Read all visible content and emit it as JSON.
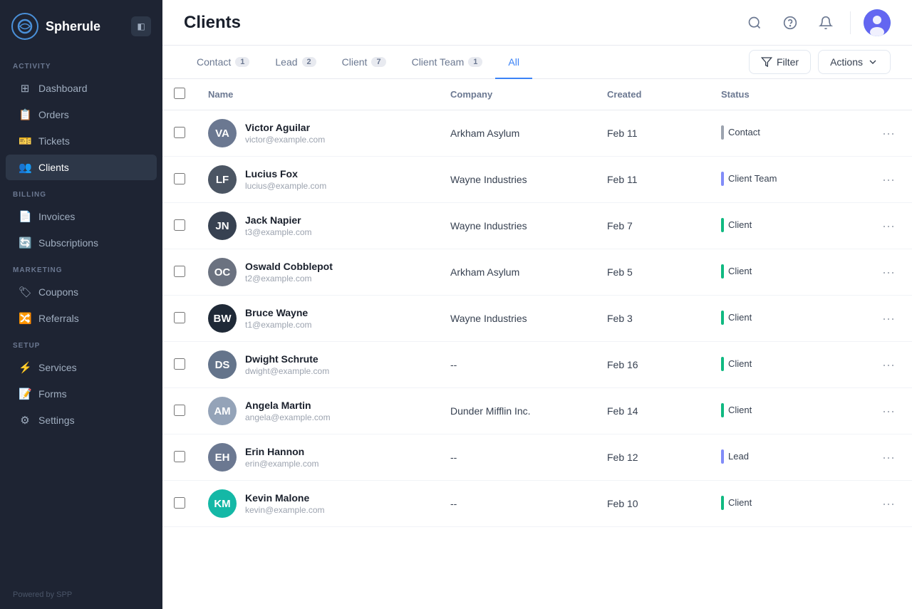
{
  "sidebar": {
    "logo": "Spherule",
    "sections": [
      {
        "label": "ACTIVITY",
        "items": [
          {
            "id": "dashboard",
            "label": "Dashboard",
            "icon": "⊞"
          },
          {
            "id": "orders",
            "label": "Orders",
            "icon": "📋"
          },
          {
            "id": "tickets",
            "label": "Tickets",
            "icon": "🎫"
          },
          {
            "id": "clients",
            "label": "Clients",
            "icon": "👥",
            "active": true
          }
        ]
      },
      {
        "label": "BILLING",
        "items": [
          {
            "id": "invoices",
            "label": "Invoices",
            "icon": "📄"
          },
          {
            "id": "subscriptions",
            "label": "Subscriptions",
            "icon": "🔄"
          }
        ]
      },
      {
        "label": "MARKETING",
        "items": [
          {
            "id": "coupons",
            "label": "Coupons",
            "icon": "🏷"
          },
          {
            "id": "referrals",
            "label": "Referrals",
            "icon": "🔀"
          }
        ]
      },
      {
        "label": "SETUP",
        "items": [
          {
            "id": "services",
            "label": "Services",
            "icon": "⚡"
          },
          {
            "id": "forms",
            "label": "Forms",
            "icon": "📝"
          },
          {
            "id": "settings",
            "label": "Settings",
            "icon": "⚙"
          }
        ]
      }
    ],
    "footer": "Powered by  SPP"
  },
  "header": {
    "title": "Clients"
  },
  "tabs": [
    {
      "id": "contact",
      "label": "Contact",
      "count": 1
    },
    {
      "id": "lead",
      "label": "Lead",
      "count": 2
    },
    {
      "id": "client",
      "label": "Client",
      "count": 7
    },
    {
      "id": "client-team",
      "label": "Client Team",
      "count": 1
    },
    {
      "id": "all",
      "label": "All",
      "count": null,
      "active": true
    }
  ],
  "toolbar": {
    "filter_label": "Filter",
    "actions_label": "Actions"
  },
  "table": {
    "columns": [
      "Name",
      "Company",
      "Created",
      "Status"
    ],
    "rows": [
      {
        "name": "Victor Aguilar",
        "email": "victor@example.com",
        "company": "Arkham Asylum",
        "created": "Feb 11",
        "status": "Contact",
        "status_type": "contact",
        "avatar_color": "#6b7891",
        "avatar_initials": "VA",
        "avatar_img": true
      },
      {
        "name": "Lucius Fox",
        "email": "lucius@example.com",
        "company": "Wayne Industries",
        "created": "Feb 11",
        "status": "Client Team",
        "status_type": "client-team",
        "avatar_color": "#6b7280",
        "avatar_initials": "LF",
        "avatar_img": true
      },
      {
        "name": "Jack Napier",
        "email": "t3@example.com",
        "company": "Wayne Industries",
        "created": "Feb 7",
        "status": "Client",
        "status_type": "client",
        "avatar_color": "#9ca3af",
        "avatar_initials": "JN",
        "avatar_img": true
      },
      {
        "name": "Oswald Cobblepot",
        "email": "t2@example.com",
        "company": "Arkham Asylum",
        "created": "Feb 5",
        "status": "Client",
        "status_type": "client",
        "avatar_color": "#9ca3af",
        "avatar_initials": "OC",
        "avatar_img": true
      },
      {
        "name": "Bruce Wayne",
        "email": "t1@example.com",
        "company": "Wayne Industries",
        "created": "Feb 3",
        "status": "Client",
        "status_type": "client",
        "avatar_color": "#374151",
        "avatar_initials": "BW",
        "avatar_img": true
      },
      {
        "name": "Dwight Schrute",
        "email": "dwight@example.com",
        "company": "--",
        "created": "Feb 16",
        "status": "Client",
        "status_type": "client",
        "avatar_color": "#9ca3af",
        "avatar_initials": "DS",
        "avatar_img": true
      },
      {
        "name": "Angela Martin",
        "email": "angela@example.com",
        "company": "Dunder Mifflin Inc.",
        "created": "Feb 14",
        "status": "Client",
        "status_type": "client",
        "avatar_color": "#d1d5db",
        "avatar_initials": "AM",
        "avatar_img": true
      },
      {
        "name": "Erin Hannon",
        "email": "erin@example.com",
        "company": "--",
        "created": "Feb 12",
        "status": "Lead",
        "status_type": "lead",
        "avatar_color": "#9ca3af",
        "avatar_initials": "EH",
        "avatar_img": true
      },
      {
        "name": "Kevin Malone",
        "email": "kevin@example.com",
        "company": "--",
        "created": "Feb 10",
        "status": "Client",
        "status_type": "client",
        "avatar_color": "#14b8a6",
        "avatar_initials": "KM",
        "avatar_img": false
      }
    ]
  }
}
